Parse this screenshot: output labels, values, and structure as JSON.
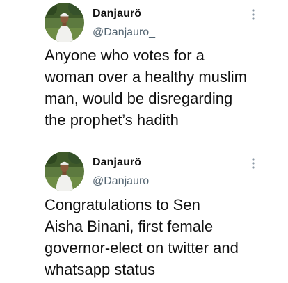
{
  "tweets": [
    {
      "author": {
        "name": "Danjaurö",
        "handle": "@Danjauro_"
      },
      "text_lines": [
        "Anyone who votes for a",
        "woman over a healthy muslim",
        "man, would be disregarding",
        "the prophet’s hadith"
      ],
      "more_icon": "more-vertical-icon"
    },
    {
      "author": {
        "name": "Danjaurö",
        "handle": "@Danjauro_"
      },
      "text_lines": [
        "Congratulations to Sen",
        "Aisha Binani, first female",
        "governor-elect on twitter and",
        "whatsapp status"
      ],
      "more_icon": "more-vertical-icon"
    }
  ],
  "colors": {
    "text": "#111111",
    "handle": "#536471",
    "icon": "#8b98a5",
    "background": "#ffffff"
  }
}
